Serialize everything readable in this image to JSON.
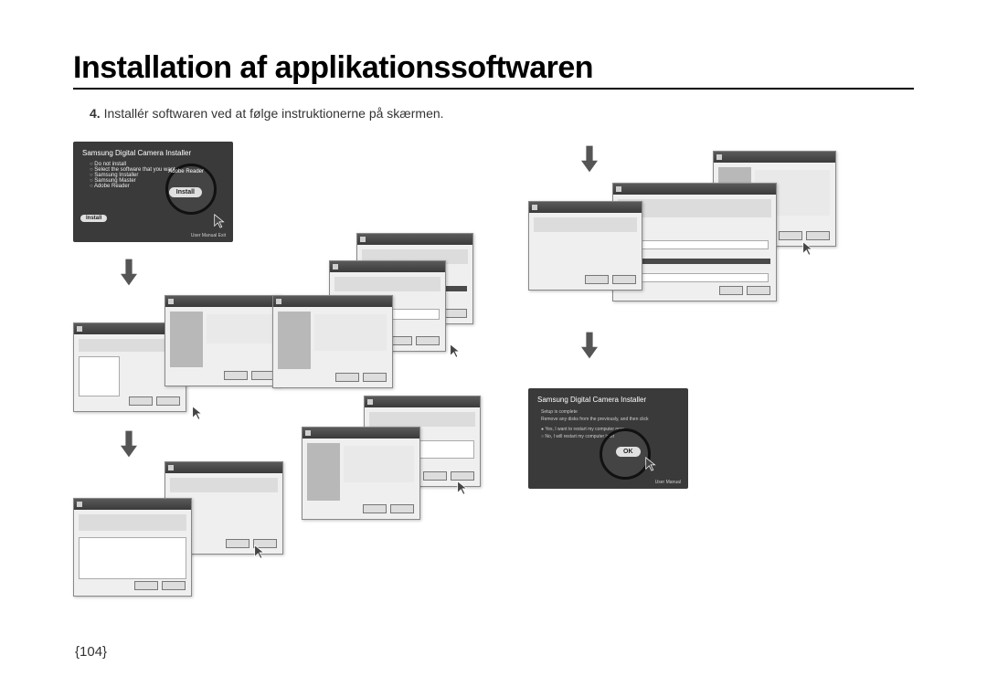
{
  "title": "Installation af applikationssoftwaren",
  "step_num": "4.",
  "step_text": "Installér softwaren ved at følge instruktionerne på skærmen.",
  "page_number": "{104}",
  "installer1": {
    "title": "Samsung Digital Camera Installer",
    "items": [
      "Do not install",
      "Select the software that you want",
      "Samsung Installer",
      "Samsung Master",
      "Adobe Reader"
    ],
    "circled_label": "Adobe Reader",
    "button_install": "Install",
    "footer": "User Manual      Exit"
  },
  "installer2": {
    "title": "Samsung Digital Camera Installer",
    "lines": [
      "Setup is complete",
      "Remove any disks from the previously, and then click",
      "Yes, I want to restart my computer now",
      "No, I will restart my computer later"
    ],
    "button_ok": "OK",
    "footer": "User Manual"
  }
}
